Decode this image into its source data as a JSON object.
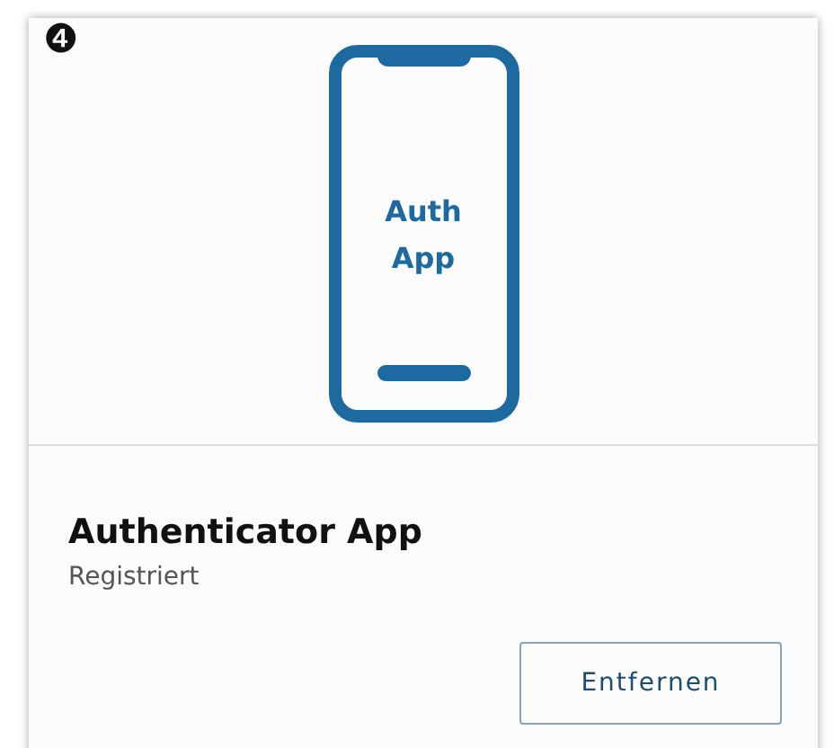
{
  "card": {
    "step_marker": "❹",
    "illustration_text": [
      "Auth",
      "App"
    ],
    "title": "Authenticator App",
    "status": "Registriert",
    "button": "Entfernen"
  }
}
